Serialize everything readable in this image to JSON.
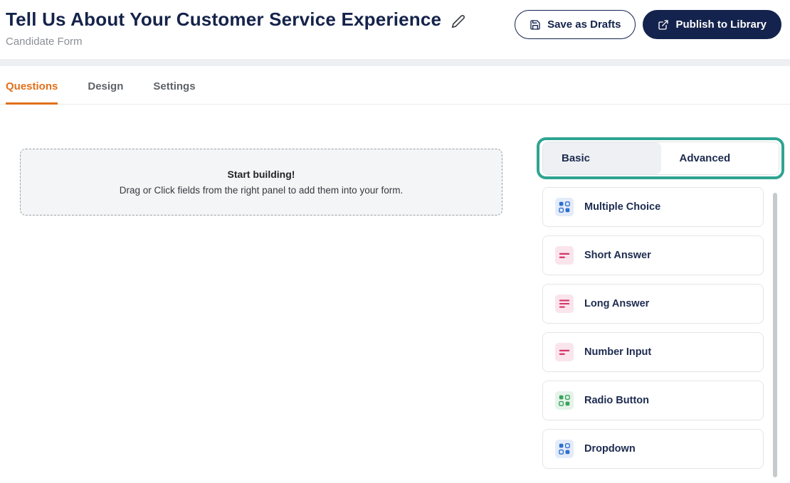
{
  "header": {
    "title": "Tell Us About Your Customer Service Experience",
    "subtitle": "Candidate Form",
    "save_button": "Save as Drafts",
    "publish_button": "Publish to Library"
  },
  "tabs": [
    {
      "label": "Questions",
      "active": true
    },
    {
      "label": "Design",
      "active": false
    },
    {
      "label": "Settings",
      "active": false
    }
  ],
  "canvas": {
    "title": "Start building!",
    "subtitle": "Drag or Click fields from the right panel to add them into your form."
  },
  "panel": {
    "toggle": [
      {
        "label": "Basic",
        "active": true
      },
      {
        "label": "Advanced",
        "active": false
      }
    ],
    "highlight_color": "#2fa491",
    "fields": [
      {
        "label": "Multiple Choice",
        "icon": "multiple-choice-icon",
        "color": "#2f6fd0"
      },
      {
        "label": "Short Answer",
        "icon": "short-answer-icon",
        "color": "#d6336c"
      },
      {
        "label": "Long Answer",
        "icon": "long-answer-icon",
        "color": "#d6336c"
      },
      {
        "label": "Number Input",
        "icon": "number-input-icon",
        "color": "#d6336c"
      },
      {
        "label": "Radio Button",
        "icon": "radio-button-icon",
        "color": "#37a45a"
      },
      {
        "label": "Dropdown",
        "icon": "dropdown-icon",
        "color": "#2f6fd0"
      }
    ]
  },
  "colors": {
    "accent_orange": "#e2701b",
    "navy": "#14234d"
  }
}
